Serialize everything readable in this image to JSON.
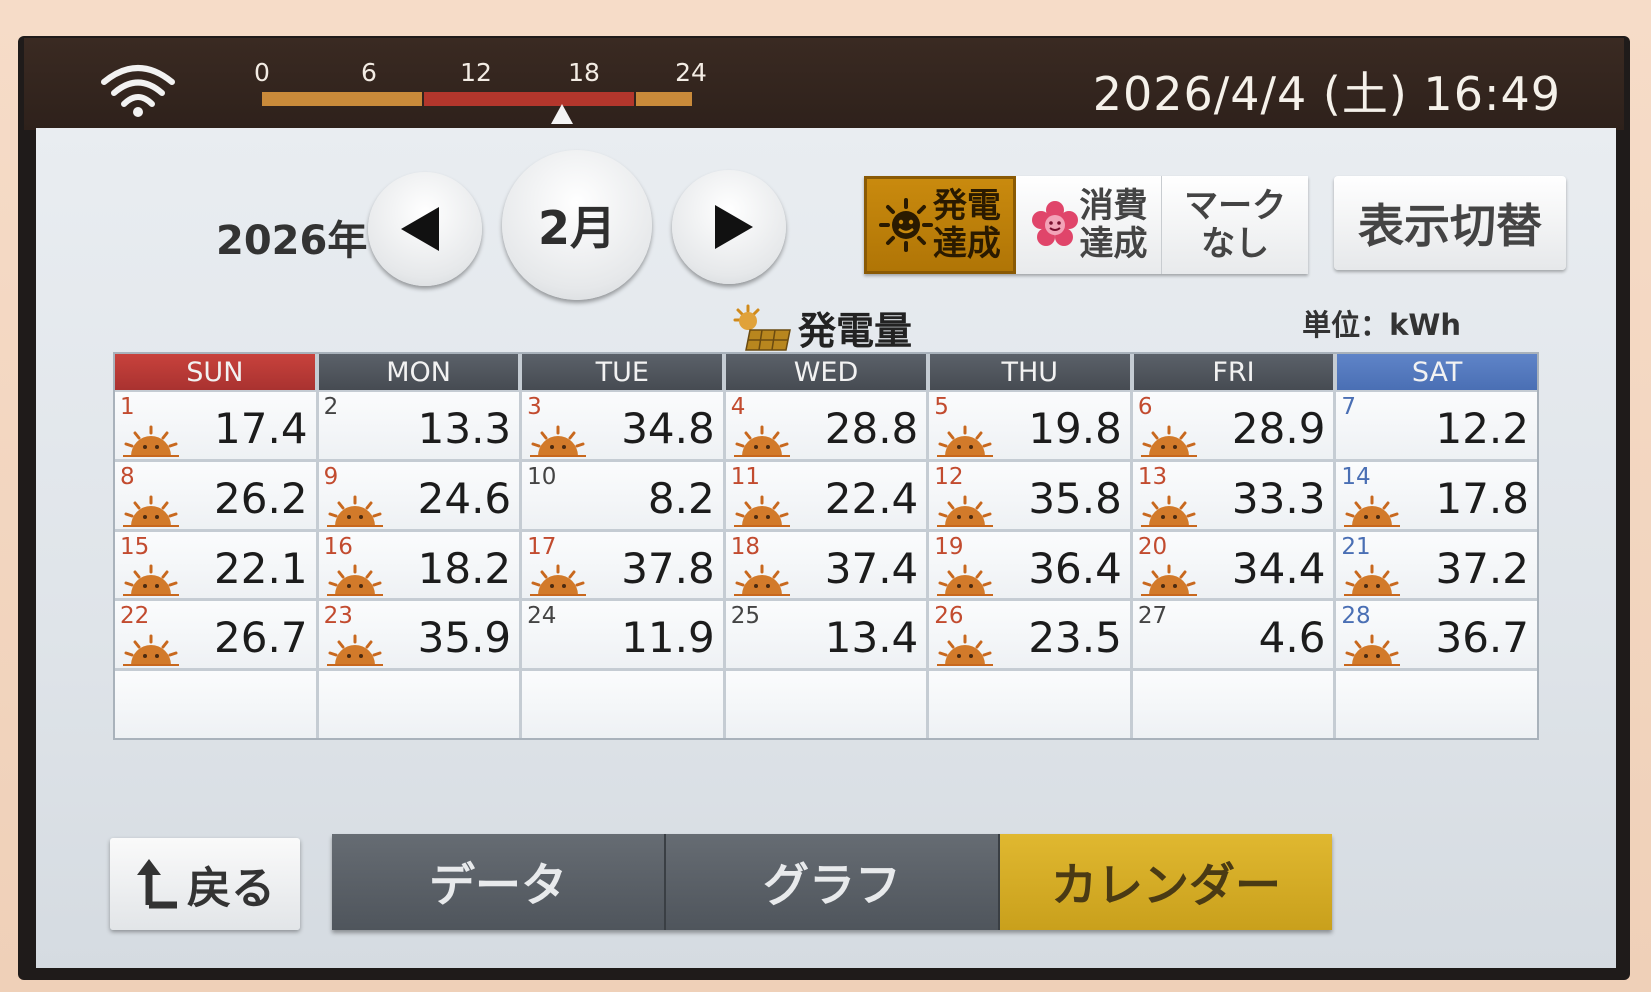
{
  "status": {
    "clock": "2026/4/4 (土) 16:49",
    "timeline_labels": [
      "0",
      "6",
      "12",
      "18",
      "24"
    ],
    "timeline_position_hours": 16.8,
    "colors": {
      "day_band": "#c98a3a",
      "peak_band": "#b3362c"
    }
  },
  "nav": {
    "year": "2026年",
    "month": "2月",
    "prev_icon": "triangle-left-icon",
    "next_icon": "triangle-right-icon"
  },
  "mark_options": [
    {
      "label": "発電\n達成",
      "icon": "sun-face-icon",
      "active": true
    },
    {
      "label": "消費\n達成",
      "icon": "flower-icon",
      "active": false
    },
    {
      "label": "マーク\nなし",
      "icon": "",
      "active": false
    }
  ],
  "switch_label": "表示切替",
  "calendar": {
    "title": "発電量",
    "unit": "単位：kWh",
    "weekdays": [
      "SUN",
      "MON",
      "TUE",
      "WED",
      "THU",
      "FRI",
      "SAT"
    ],
    "days": [
      {
        "day": "1",
        "value": "17.4",
        "mark": true
      },
      {
        "day": "2",
        "value": "13.3",
        "mark": false
      },
      {
        "day": "3",
        "value": "34.8",
        "mark": true
      },
      {
        "day": "4",
        "value": "28.8",
        "mark": true
      },
      {
        "day": "5",
        "value": "19.8",
        "mark": true
      },
      {
        "day": "6",
        "value": "28.9",
        "mark": true
      },
      {
        "day": "7",
        "value": "12.2",
        "mark": false
      },
      {
        "day": "8",
        "value": "26.2",
        "mark": true
      },
      {
        "day": "9",
        "value": "24.6",
        "mark": true
      },
      {
        "day": "10",
        "value": "8.2",
        "mark": false
      },
      {
        "day": "11",
        "value": "22.4",
        "mark": true
      },
      {
        "day": "12",
        "value": "35.8",
        "mark": true
      },
      {
        "day": "13",
        "value": "33.3",
        "mark": true
      },
      {
        "day": "14",
        "value": "17.8",
        "mark": true
      },
      {
        "day": "15",
        "value": "22.1",
        "mark": true
      },
      {
        "day": "16",
        "value": "18.2",
        "mark": true
      },
      {
        "day": "17",
        "value": "37.8",
        "mark": true
      },
      {
        "day": "18",
        "value": "37.4",
        "mark": true
      },
      {
        "day": "19",
        "value": "36.4",
        "mark": true
      },
      {
        "day": "20",
        "value": "34.4",
        "mark": true
      },
      {
        "day": "21",
        "value": "37.2",
        "mark": true
      },
      {
        "day": "22",
        "value": "26.7",
        "mark": true
      },
      {
        "day": "23",
        "value": "35.9",
        "mark": true
      },
      {
        "day": "24",
        "value": "11.9",
        "mark": false
      },
      {
        "day": "25",
        "value": "13.4",
        "mark": false
      },
      {
        "day": "26",
        "value": "23.5",
        "mark": true
      },
      {
        "day": "27",
        "value": "4.6",
        "mark": false
      },
      {
        "day": "28",
        "value": "36.7",
        "mark": true
      }
    ]
  },
  "bottom": {
    "back_label": "戻る",
    "tabs": [
      {
        "label": "データ",
        "active": false
      },
      {
        "label": "グラフ",
        "active": false
      },
      {
        "label": "カレンダー",
        "active": true
      }
    ]
  }
}
